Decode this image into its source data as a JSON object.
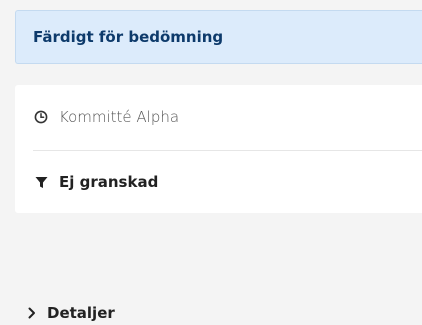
{
  "status": {
    "label": "Färdigt för bedömning"
  },
  "card": {
    "committee": {
      "icon": "clock-icon",
      "label": "Kommitté Alpha"
    },
    "filter": {
      "icon": "filter-icon",
      "label": "Ej granskad"
    }
  },
  "details": {
    "icon": "chevron-right-icon",
    "label": "Detaljer"
  },
  "colors": {
    "banner_background": "#dcebfb",
    "banner_text": "#0d3a6b",
    "page_background": "#f4f4f4",
    "card_background": "#ffffff"
  }
}
